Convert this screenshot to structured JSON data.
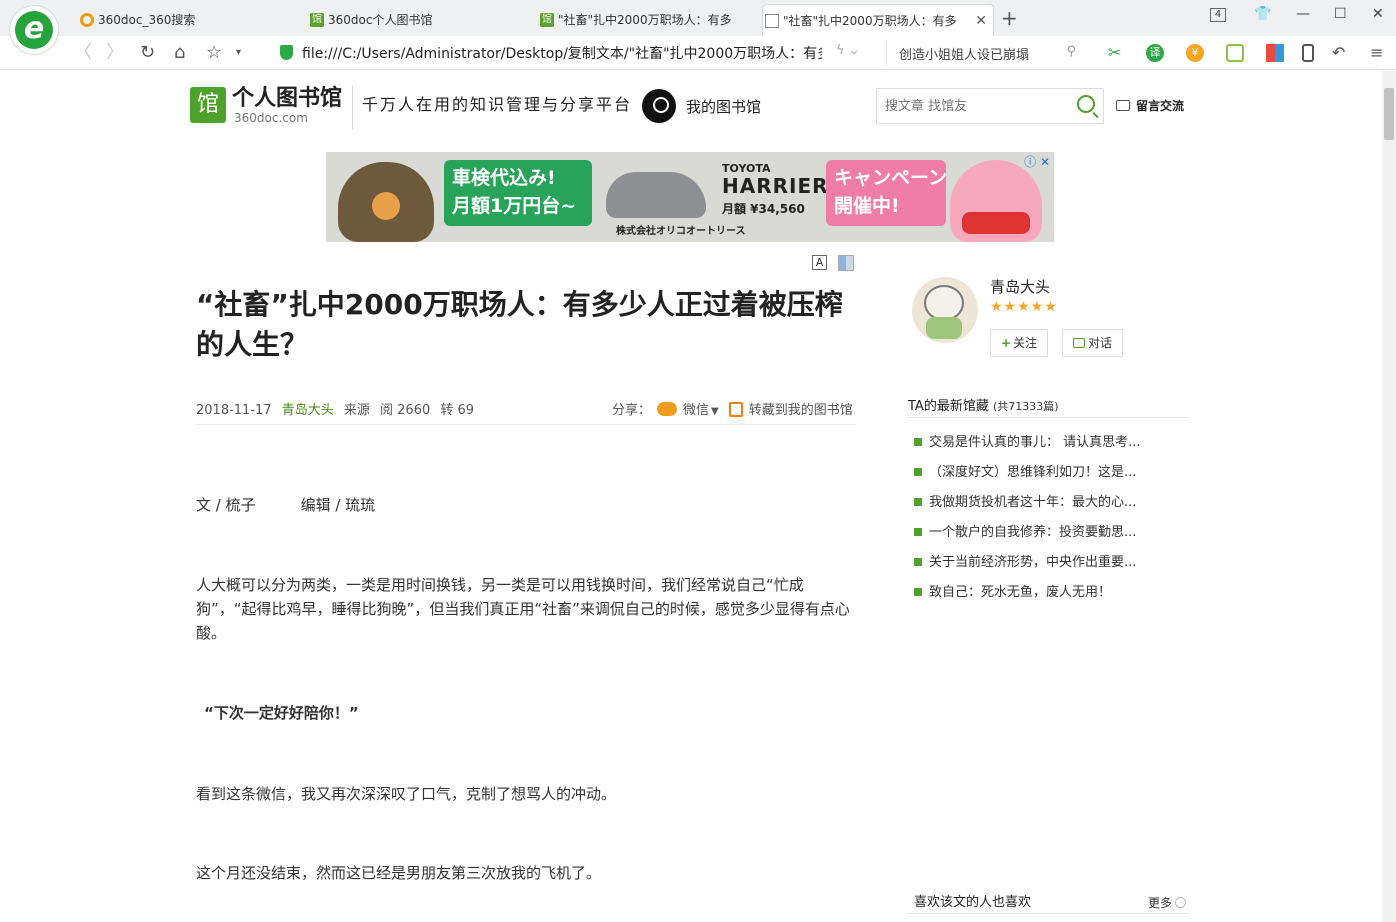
{
  "browser": {
    "tabs": [
      {
        "label": "360doc_360搜索"
      },
      {
        "label": "360doc个人图书馆"
      },
      {
        "label": "\"社畜\"扎中2000万职场人：有多"
      },
      {
        "label": "\"社畜\"扎中2000万职场人：有多"
      }
    ],
    "tab_count": "4",
    "address": "file:///C:/Users/Administrator/Desktop/复制文本/\"社畜\"扎中2000万职场人：有多",
    "search_query": "创造小姐姐人设已崩塌",
    "accent": "#2eaa45"
  },
  "site": {
    "name": "个人图书馆",
    "domain": "360doc.com",
    "slogan": "千万人在用的知识管理与分享平台",
    "my_library": "我的图书馆",
    "search_placeholder": "搜文章 找馆友",
    "message": "留言交流",
    "brand_color": "#4ea12b"
  },
  "ad": {
    "left_text": "車検代込み!\n月額1万円台~",
    "brand": "TOYOTA",
    "model": "HARRIER",
    "price": "月額 ¥34,560",
    "company": "株式会社オリコオートリース",
    "right_text": "キャンペーン\n開催中!"
  },
  "article": {
    "title": "“社畜”扎中2000万职场人：有多少人正过着被压榨的人生？",
    "date": "2018-11-17",
    "author": "青岛大头",
    "source_label": "来源",
    "reads": "阅 2660",
    "reposts": "转 69",
    "share_label": "分享：",
    "wechat_label": "微信",
    "save_label": "转藏到我的图书馆",
    "paragraphs": [
      "文 / 梳子　　　编辑 / 琉琉",
      "人大概可以分为两类，一类是用时间换钱，另一类是可以用钱换时间，我们经常说自己“忙成狗”，“起得比鸡早，睡得比狗晚”，但当我们真正用“社畜”来调侃自己的时候，感觉多少显得有点心酸。",
      "“下次一定好好陪你！”",
      "看到这条微信，我又再次深深叹了口气，克制了想骂人的冲动。",
      "这个月还没结束，然而这已经是男朋友第三次放我的飞机了。"
    ]
  },
  "sidebar": {
    "user_name": "青岛大头",
    "rating_stars": 4.5,
    "follow_label": "关注",
    "chat_label": "对话",
    "latest_title": "TA的最新馆藏",
    "latest_count": "(共71333篇)",
    "latest": [
      "交易是件认真的事儿：  请认真思考...",
      "（深度好文）思维锋利如刀！这是...",
      "我做期货投机者这十年：最大的心...",
      "一个散户的自我修养：投资要勤思...",
      "关于当前经济形势，中央作出重要...",
      "致自己：死水无鱼，废人无用！"
    ],
    "like_title": "喜欢该文的人也喜欢",
    "more_label": "更多"
  }
}
